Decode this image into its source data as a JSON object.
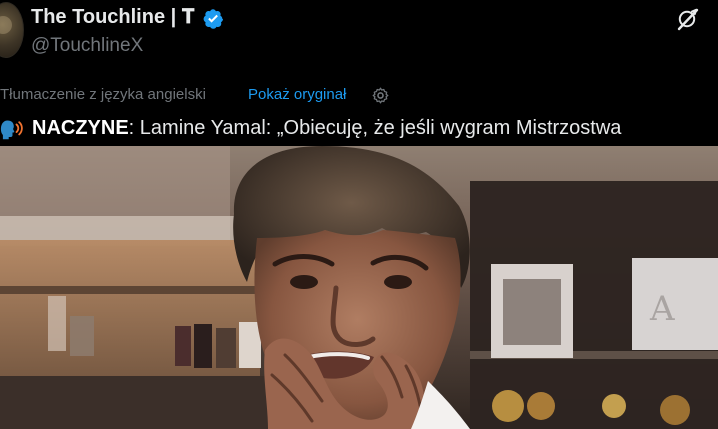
{
  "author": {
    "display_name": "The Touchline | 𝐓",
    "handle": "@TouchlineX",
    "verified": true,
    "verified_color": "#1d9bf0"
  },
  "translation": {
    "note": "Tłumaczenie z języka angielski",
    "show_original": "Pokaż oryginał",
    "link_color": "#1d9bf0"
  },
  "tweet": {
    "emoji": "🗣️",
    "tag": "NACZYNE",
    "text": ": Lamine Yamal: „Obiecuję, że jeśli wygram Mistrzostwa"
  },
  "media": {
    "type": "video-still",
    "description_icon": "player-photo"
  },
  "icons": {
    "verified": "verified-badge-icon",
    "grok": "grok-icon",
    "settings": "gear-icon",
    "speaking_head": "speaking-head-icon"
  },
  "colors": {
    "background": "#000000",
    "text_primary": "#e7e9ea",
    "text_secondary": "#71767b",
    "accent": "#1d9bf0"
  }
}
